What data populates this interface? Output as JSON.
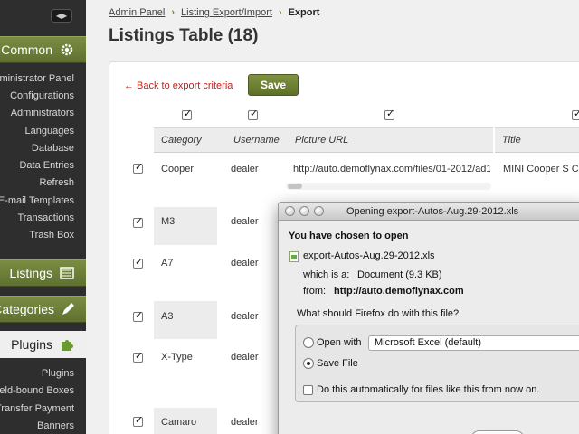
{
  "sidebar": {
    "common": {
      "label": "Common",
      "icon": "gear-icon"
    },
    "common_items": [
      "Administrator Panel",
      "Configurations",
      "Administrators",
      "Languages",
      "Database",
      "Data Entries",
      "Refresh",
      "E-mail Templates",
      "Transactions",
      "Trash Box"
    ],
    "listings": {
      "label": "Listings",
      "icon": "listings-icon"
    },
    "categories": {
      "label": "Categories",
      "icon": "pencil-icon"
    },
    "plugins": {
      "label": "Plugins",
      "icon": "puzzle-icon"
    },
    "plugin_items": [
      "Plugins",
      "Field-bound Boxes",
      "Transfer Payment",
      "Banners"
    ],
    "accent_color": "#6a7c35"
  },
  "breadcrumb": {
    "items": [
      "Admin Panel",
      "Listing Export/Import"
    ],
    "current": "Export"
  },
  "page_title": "Listings Table (18)",
  "actions": {
    "back_label": "Back to export criteria",
    "save_label": "Save"
  },
  "table": {
    "columns": [
      "Category",
      "Username",
      "Picture URL",
      "Title"
    ],
    "rows": [
      {
        "category": "Cooper",
        "username": "dealer",
        "picture_url": "http://auto.demoflynax.com/files/01-2012/ad1",
        "title": "MINI Cooper S Co"
      },
      {
        "category": "M3",
        "username": "dealer"
      },
      {
        "category": "A7",
        "username": "dealer"
      },
      {
        "category": "A3",
        "username": "dealer"
      },
      {
        "category": "X-Type",
        "username": "dealer"
      },
      {
        "category": "Camaro",
        "username": "dealer"
      }
    ]
  },
  "dialog": {
    "title": "Opening export-Autos-Aug.29-2012.xls",
    "heading": "You have chosen to open",
    "filename": "export-Autos-Aug.29-2012.xls",
    "type_label": "which is a:",
    "type_value": "Document (9.3 KB)",
    "from_label": "from:",
    "from_value": "http://auto.demoflynax.com",
    "question": "What should Firefox do with this file?",
    "open_with_label": "Open with",
    "open_with_app": "Microsoft Excel (default)",
    "save_file_label": "Save File",
    "selected_option": "save_file",
    "auto_label": "Do this automatically for files like this from now on."
  }
}
